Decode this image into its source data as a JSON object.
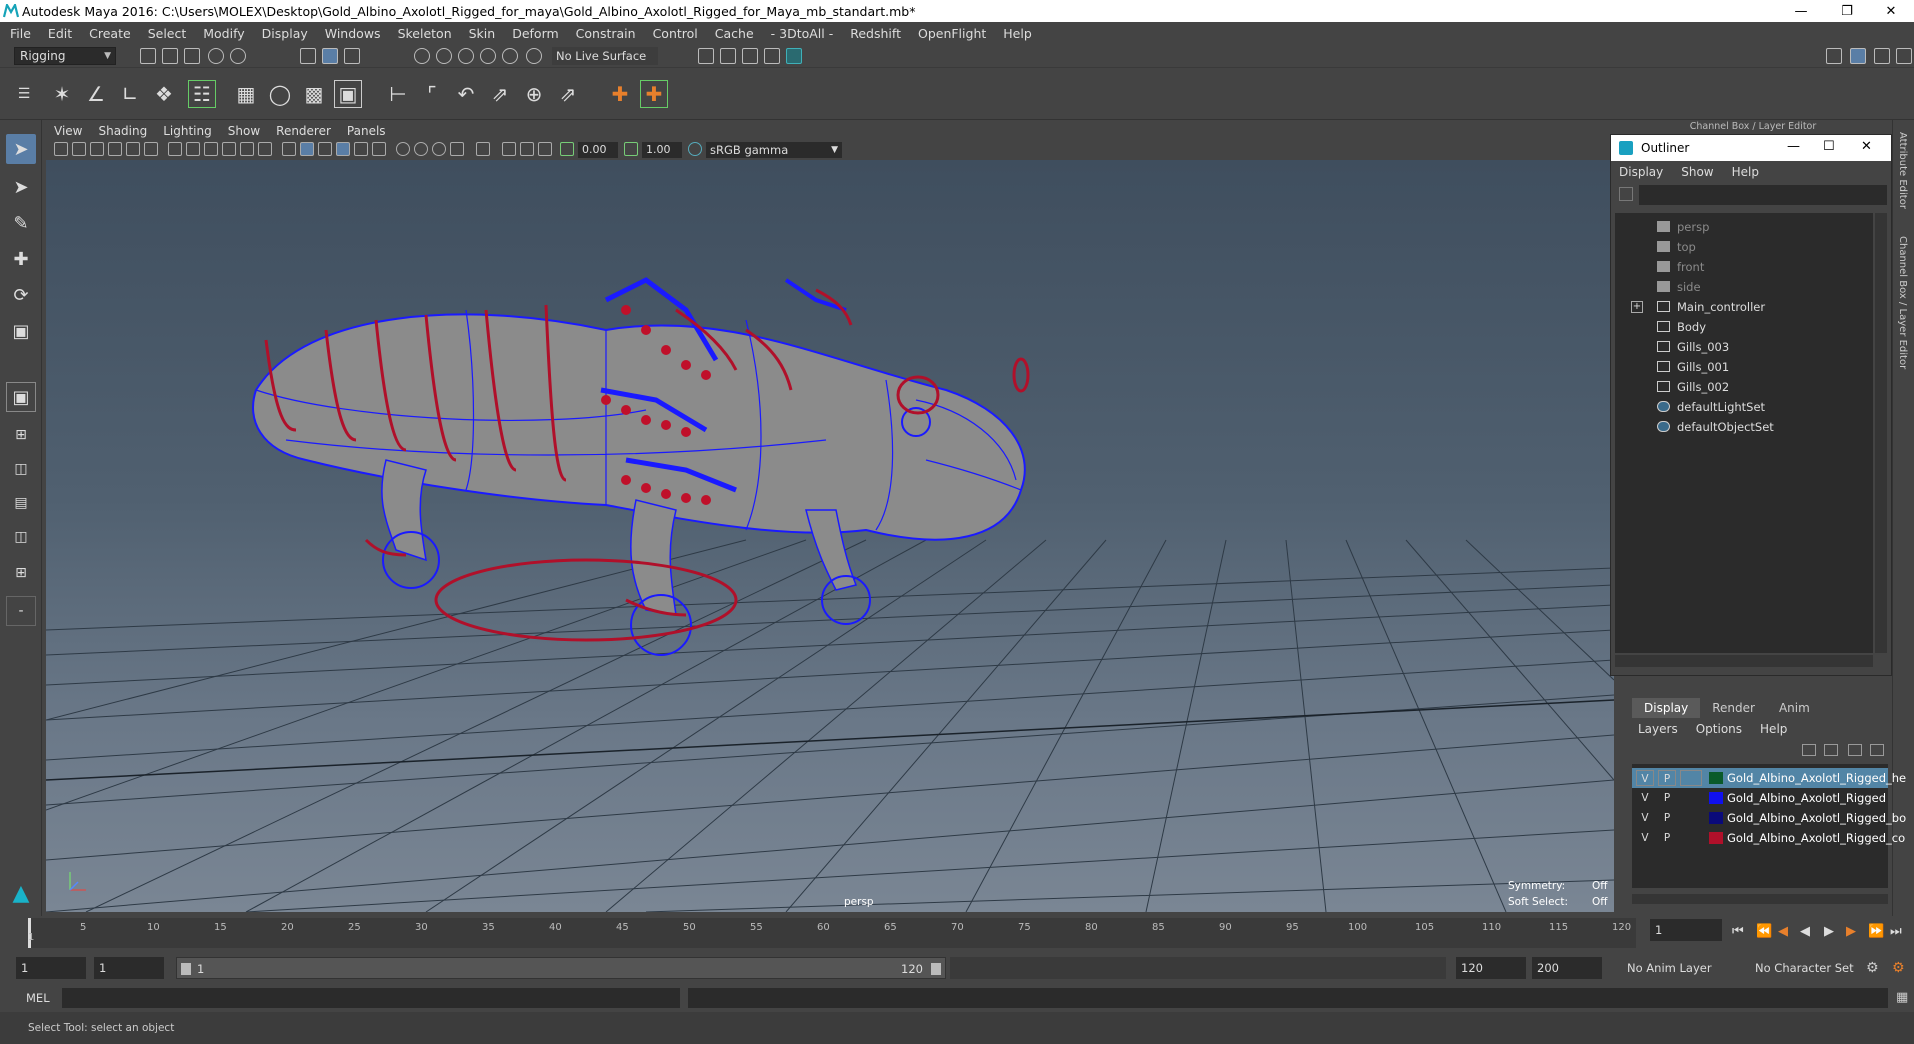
{
  "window": {
    "title": "Autodesk Maya 2016: C:\\Users\\MOLEX\\Desktop\\Gold_Albino_Axolotl_Rigged_for_maya\\Gold_Albino_Axolotl_Rigged_for_Maya_mb_standart.mb*"
  },
  "menubar": [
    "File",
    "Edit",
    "Create",
    "Select",
    "Modify",
    "Display",
    "Windows",
    "Skeleton",
    "Skin",
    "Deform",
    "Constrain",
    "Control",
    "Cache",
    "- 3DtoAll -",
    "Redshift",
    "OpenFlight",
    "Help"
  ],
  "status": {
    "menu_set": "Rigging",
    "live_surface": "No Live Surface"
  },
  "panel": {
    "menus": [
      "View",
      "Shading",
      "Lighting",
      "Show",
      "Renderer",
      "Panels"
    ],
    "exposure": "0.00",
    "gamma_value": "1.00",
    "color_space": "sRGB gamma"
  },
  "viewport": {
    "camera_label": "persp",
    "symmetry_label": "Symmetry:",
    "symmetry_value": "Off",
    "soft_select_label": "Soft Select:",
    "soft_select_value": "Off"
  },
  "side_tabs": {
    "channel_box_header": "Channel Box / Layer Editor",
    "attribute_editor": "Attribute Editor",
    "channel_box": "Channel Box / Layer Editor"
  },
  "outliner": {
    "title": "Outliner",
    "menus": [
      "Display",
      "Show",
      "Help"
    ],
    "items": [
      {
        "label": "persp",
        "type": "camera",
        "dim": true
      },
      {
        "label": "top",
        "type": "camera",
        "dim": true
      },
      {
        "label": "front",
        "type": "camera",
        "dim": true
      },
      {
        "label": "side",
        "type": "camera",
        "dim": true
      },
      {
        "label": "Main_controller",
        "type": "transform",
        "dim": false,
        "expand": true
      },
      {
        "label": "Body",
        "type": "transform",
        "dim": false
      },
      {
        "label": "Gills_003",
        "type": "transform",
        "dim": false
      },
      {
        "label": "Gills_001",
        "type": "transform",
        "dim": false
      },
      {
        "label": "Gills_002",
        "type": "transform",
        "dim": false
      },
      {
        "label": "defaultLightSet",
        "type": "set",
        "dim": false
      },
      {
        "label": "defaultObjectSet",
        "type": "set",
        "dim": false
      }
    ]
  },
  "layers": {
    "tabs": [
      "Display",
      "Render",
      "Anim"
    ],
    "menus": [
      "Layers",
      "Options",
      "Help"
    ],
    "rows": [
      {
        "v": "V",
        "p": "P",
        "color": "#0a5a2a",
        "name": "Gold_Albino_Axolotl_Rigged_he",
        "selected": true
      },
      {
        "v": "V",
        "p": "P",
        "color": "#1010ee",
        "name": "Gold_Albino_Axolotl_Rigged",
        "selected": false
      },
      {
        "v": "V",
        "p": "P",
        "color": "#0a0a7a",
        "name": "Gold_Albino_Axolotl_Rigged_bo",
        "selected": false
      },
      {
        "v": "V",
        "p": "P",
        "color": "#b0102a",
        "name": "Gold_Albino_Axolotl_Rigged_co",
        "selected": false
      }
    ]
  },
  "timeline": {
    "ticks": [
      "5",
      "10",
      "15",
      "20",
      "25",
      "30",
      "35",
      "40",
      "45",
      "50",
      "55",
      "60",
      "65",
      "70",
      "75",
      "80",
      "85",
      "90",
      "95",
      "100",
      "105",
      "110",
      "115",
      "120"
    ],
    "start_tick": "1",
    "current_frame": "1"
  },
  "range": {
    "start": "1",
    "playback_start": "1",
    "slider_start": "1",
    "slider_end": "120",
    "playback_end": "120",
    "end": "200",
    "anim_layer": "No Anim Layer",
    "character_set": "No Character Set"
  },
  "cmdline": {
    "label": "MEL"
  },
  "helpline": {
    "text": "Select Tool: select an object"
  }
}
